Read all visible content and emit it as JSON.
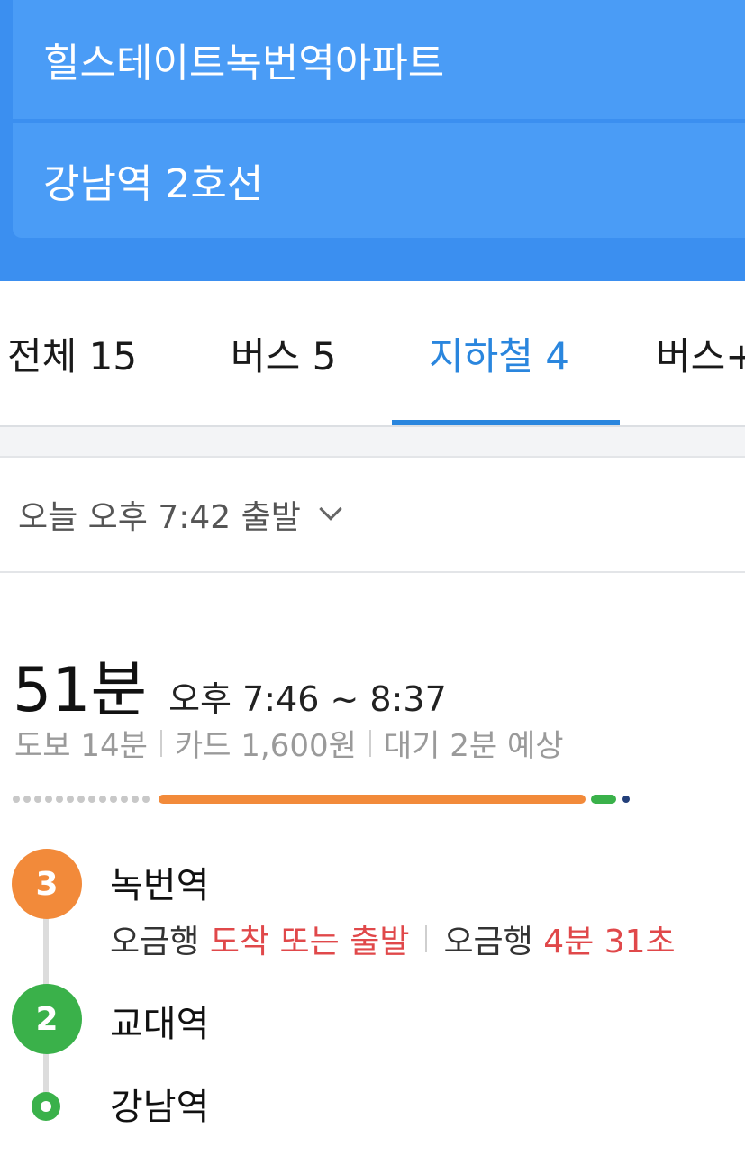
{
  "search": {
    "origin": "힐스테이트녹번역아파트",
    "destination": "강남역 2호선"
  },
  "tabs": [
    {
      "label": "전체 15"
    },
    {
      "label": "버스 5"
    },
    {
      "label": "지하철 4",
      "active": true
    },
    {
      "label": "버스+"
    }
  ],
  "departure": {
    "label": "오늘 오후 7:42 출발"
  },
  "route": {
    "duration": "51분",
    "time_range": "오후 7:46 ~ 8:37",
    "walk": "도보 14분",
    "fare": "카드 1,600원",
    "wait": "대기 2분 예상",
    "colors": {
      "line3": "#f28a3a",
      "line2": "#3ab14a",
      "walk": "#c8c8c8",
      "end": "#233f7a"
    },
    "steps": [
      {
        "line": "3",
        "station": "녹번역",
        "dir1": "오금행",
        "status1": "도착 또는 출발",
        "dir2": "오금행",
        "status2": "4분 31초"
      },
      {
        "line": "2",
        "station": "교대역"
      },
      {
        "station": "강남역"
      }
    ]
  }
}
